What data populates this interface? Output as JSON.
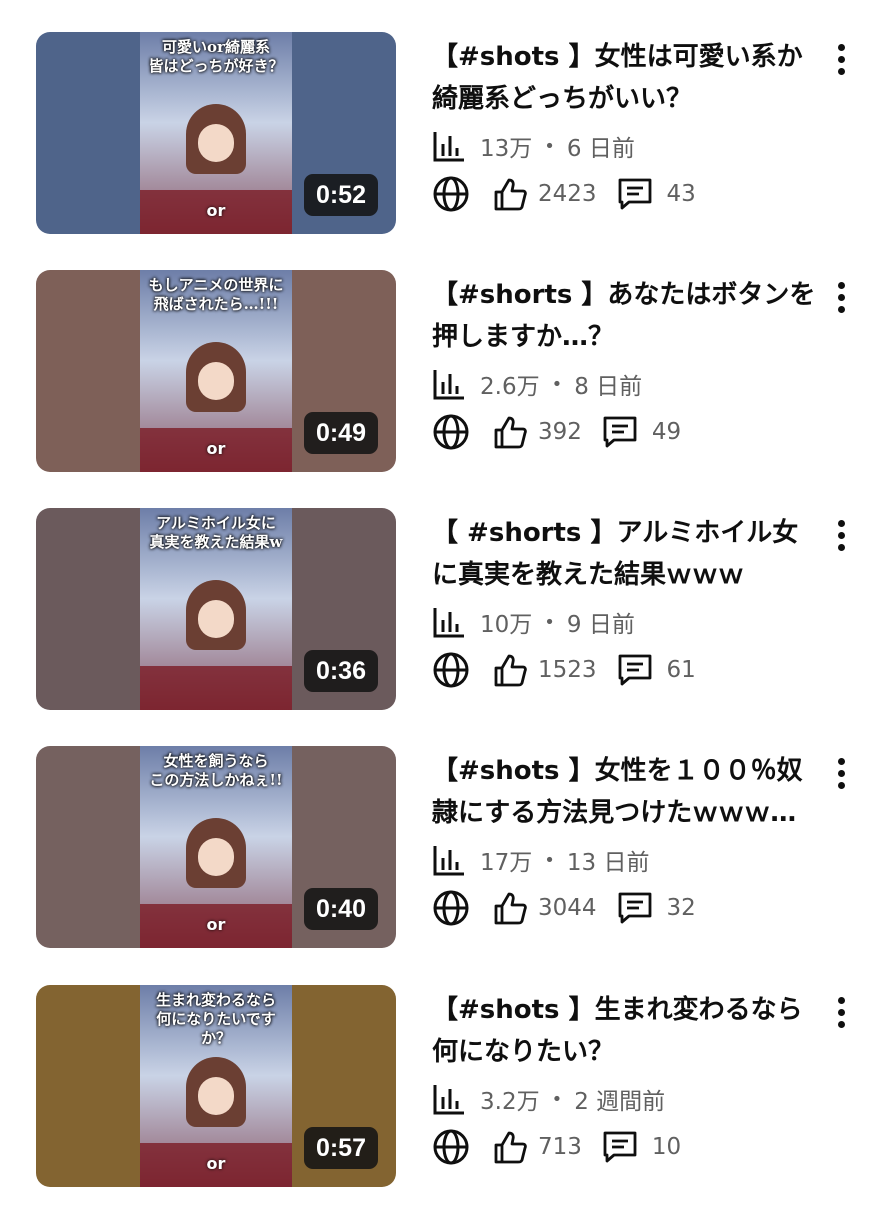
{
  "videos": [
    {
      "title": "【#shots 】女性は可愛い系か綺麗系どっちがいい？",
      "thumb_caption": "可愛いor綺麗系\n皆はどっちが好き？",
      "thumb_or": "or",
      "duration": "0:52",
      "views": "13万",
      "age": "6 日前",
      "likes": "2423",
      "comments": "43",
      "bg_color": "#4f648a"
    },
    {
      "title": "【#shorts 】あなたはボタンを押しますか…？",
      "thumb_caption": "もしアニメの世界に\n飛ばされたら…!!!",
      "thumb_or": "or",
      "duration": "0:49",
      "views": "2.6万",
      "age": "8 日前",
      "likes": "392",
      "comments": "49",
      "bg_color": "#7e6058"
    },
    {
      "title": "【 #shorts 】アルミホイル女に真実を教えた結果ｗｗｗ",
      "thumb_caption": "アルミホイル女に\n真実を教えた結果w",
      "thumb_or": "",
      "duration": "0:36",
      "views": "10万",
      "age": "9 日前",
      "likes": "1523",
      "comments": "61",
      "bg_color": "#6b5a5c"
    },
    {
      "title": "【#shots 】女性を１００％奴隷にする方法見つけたｗｗｗ…",
      "thumb_caption": "女性を飼うなら\nこの方法しかねぇ!!",
      "thumb_or": "or",
      "duration": "0:40",
      "views": "17万",
      "age": "13 日前",
      "likes": "3044",
      "comments": "32",
      "bg_color": "#75615f"
    },
    {
      "title": "【#shots 】生まれ変わるなら何になりたい？",
      "thumb_caption": "生まれ変わるなら\n何になりたいですか？",
      "thumb_or": "or",
      "duration": "0:57",
      "views": "3.2万",
      "age": "2 週間前",
      "likes": "713",
      "comments": "10",
      "bg_color": "#836431"
    }
  ],
  "meta_separator": "•",
  "icons": {
    "stats": "bar-chart-icon",
    "visibility": "globe-icon",
    "likes": "thumbs-up-icon",
    "comments": "comment-icon",
    "more": "more-vertical-icon"
  }
}
